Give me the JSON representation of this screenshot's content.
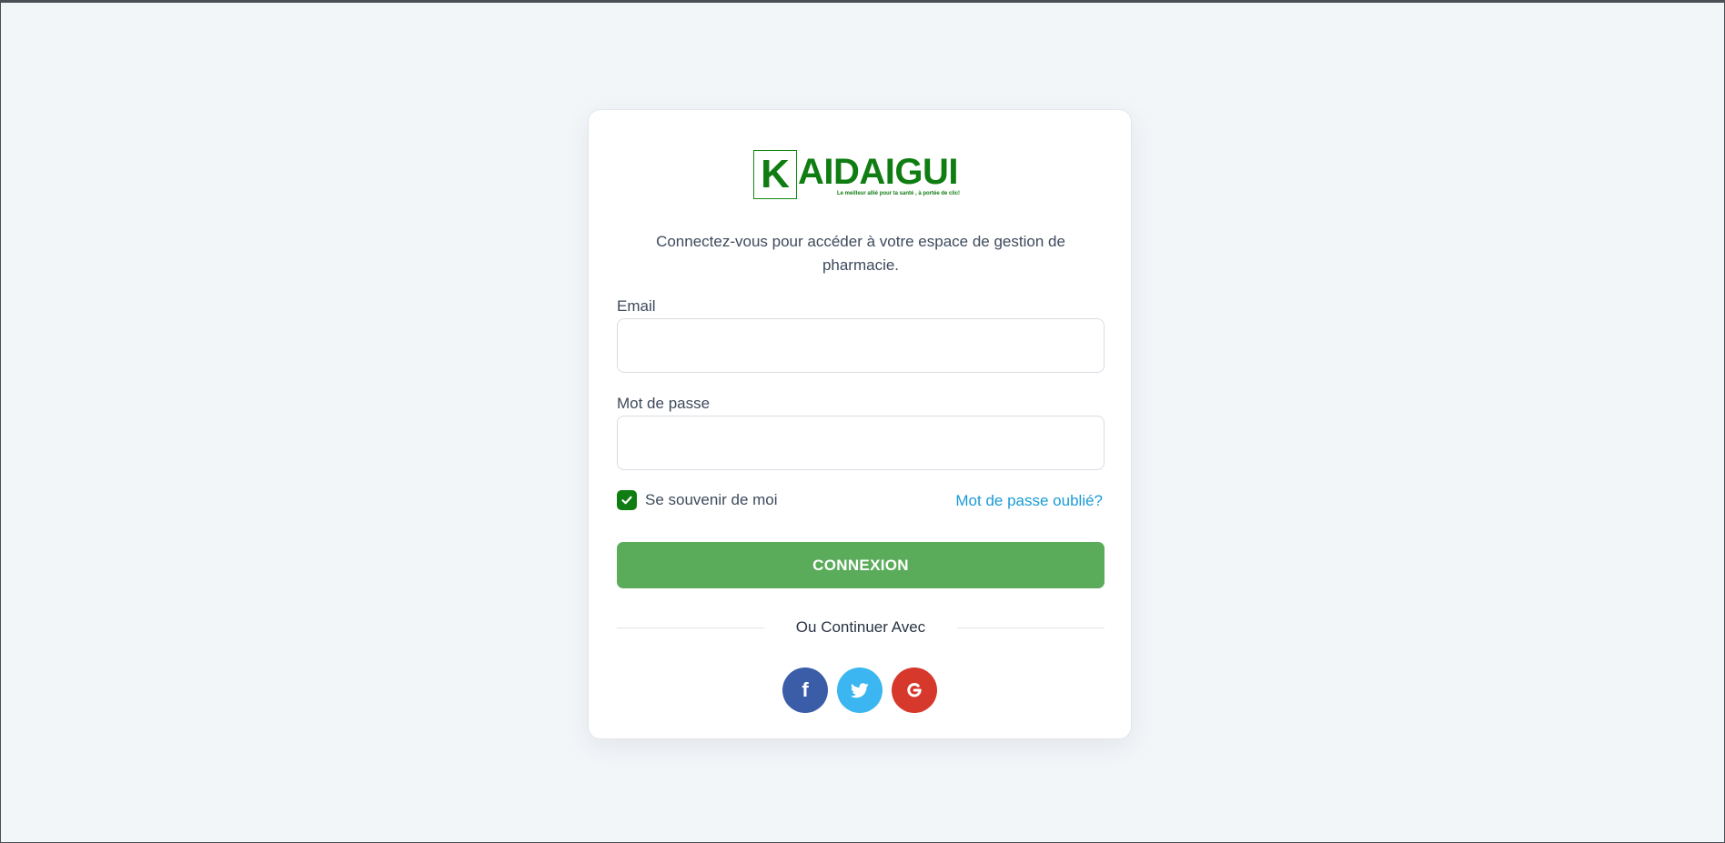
{
  "brand": {
    "logo_initial": "K",
    "logo_rest": "AIDAIGUI",
    "tagline": "Le meilleur allié pour ta santé , à portée de clic!",
    "color": "#0f7d12"
  },
  "intro": "Connectez-vous pour accéder à votre espace de gestion de pharmacie.",
  "form": {
    "email_label": "Email",
    "email_value": "",
    "password_label": "Mot de passe",
    "password_value": "",
    "remember_label": "Se souvenir de moi",
    "remember_checked": true,
    "forgot_link": "Mot de passe oublié?",
    "submit_label": "CONNEXION"
  },
  "social": {
    "divider_text": "Ou Continuer Avec",
    "buttons": [
      {
        "name": "facebook",
        "icon": "facebook-icon",
        "color": "#3b5da8"
      },
      {
        "name": "twitter",
        "icon": "twitter-icon",
        "color": "#3cb6f0"
      },
      {
        "name": "google",
        "icon": "google-icon",
        "color": "#d6392c"
      }
    ]
  },
  "colors": {
    "background": "#f3f6f9",
    "primary_button": "#5aac5a",
    "link": "#1a9bd6",
    "checkbox": "#0f7d12"
  }
}
